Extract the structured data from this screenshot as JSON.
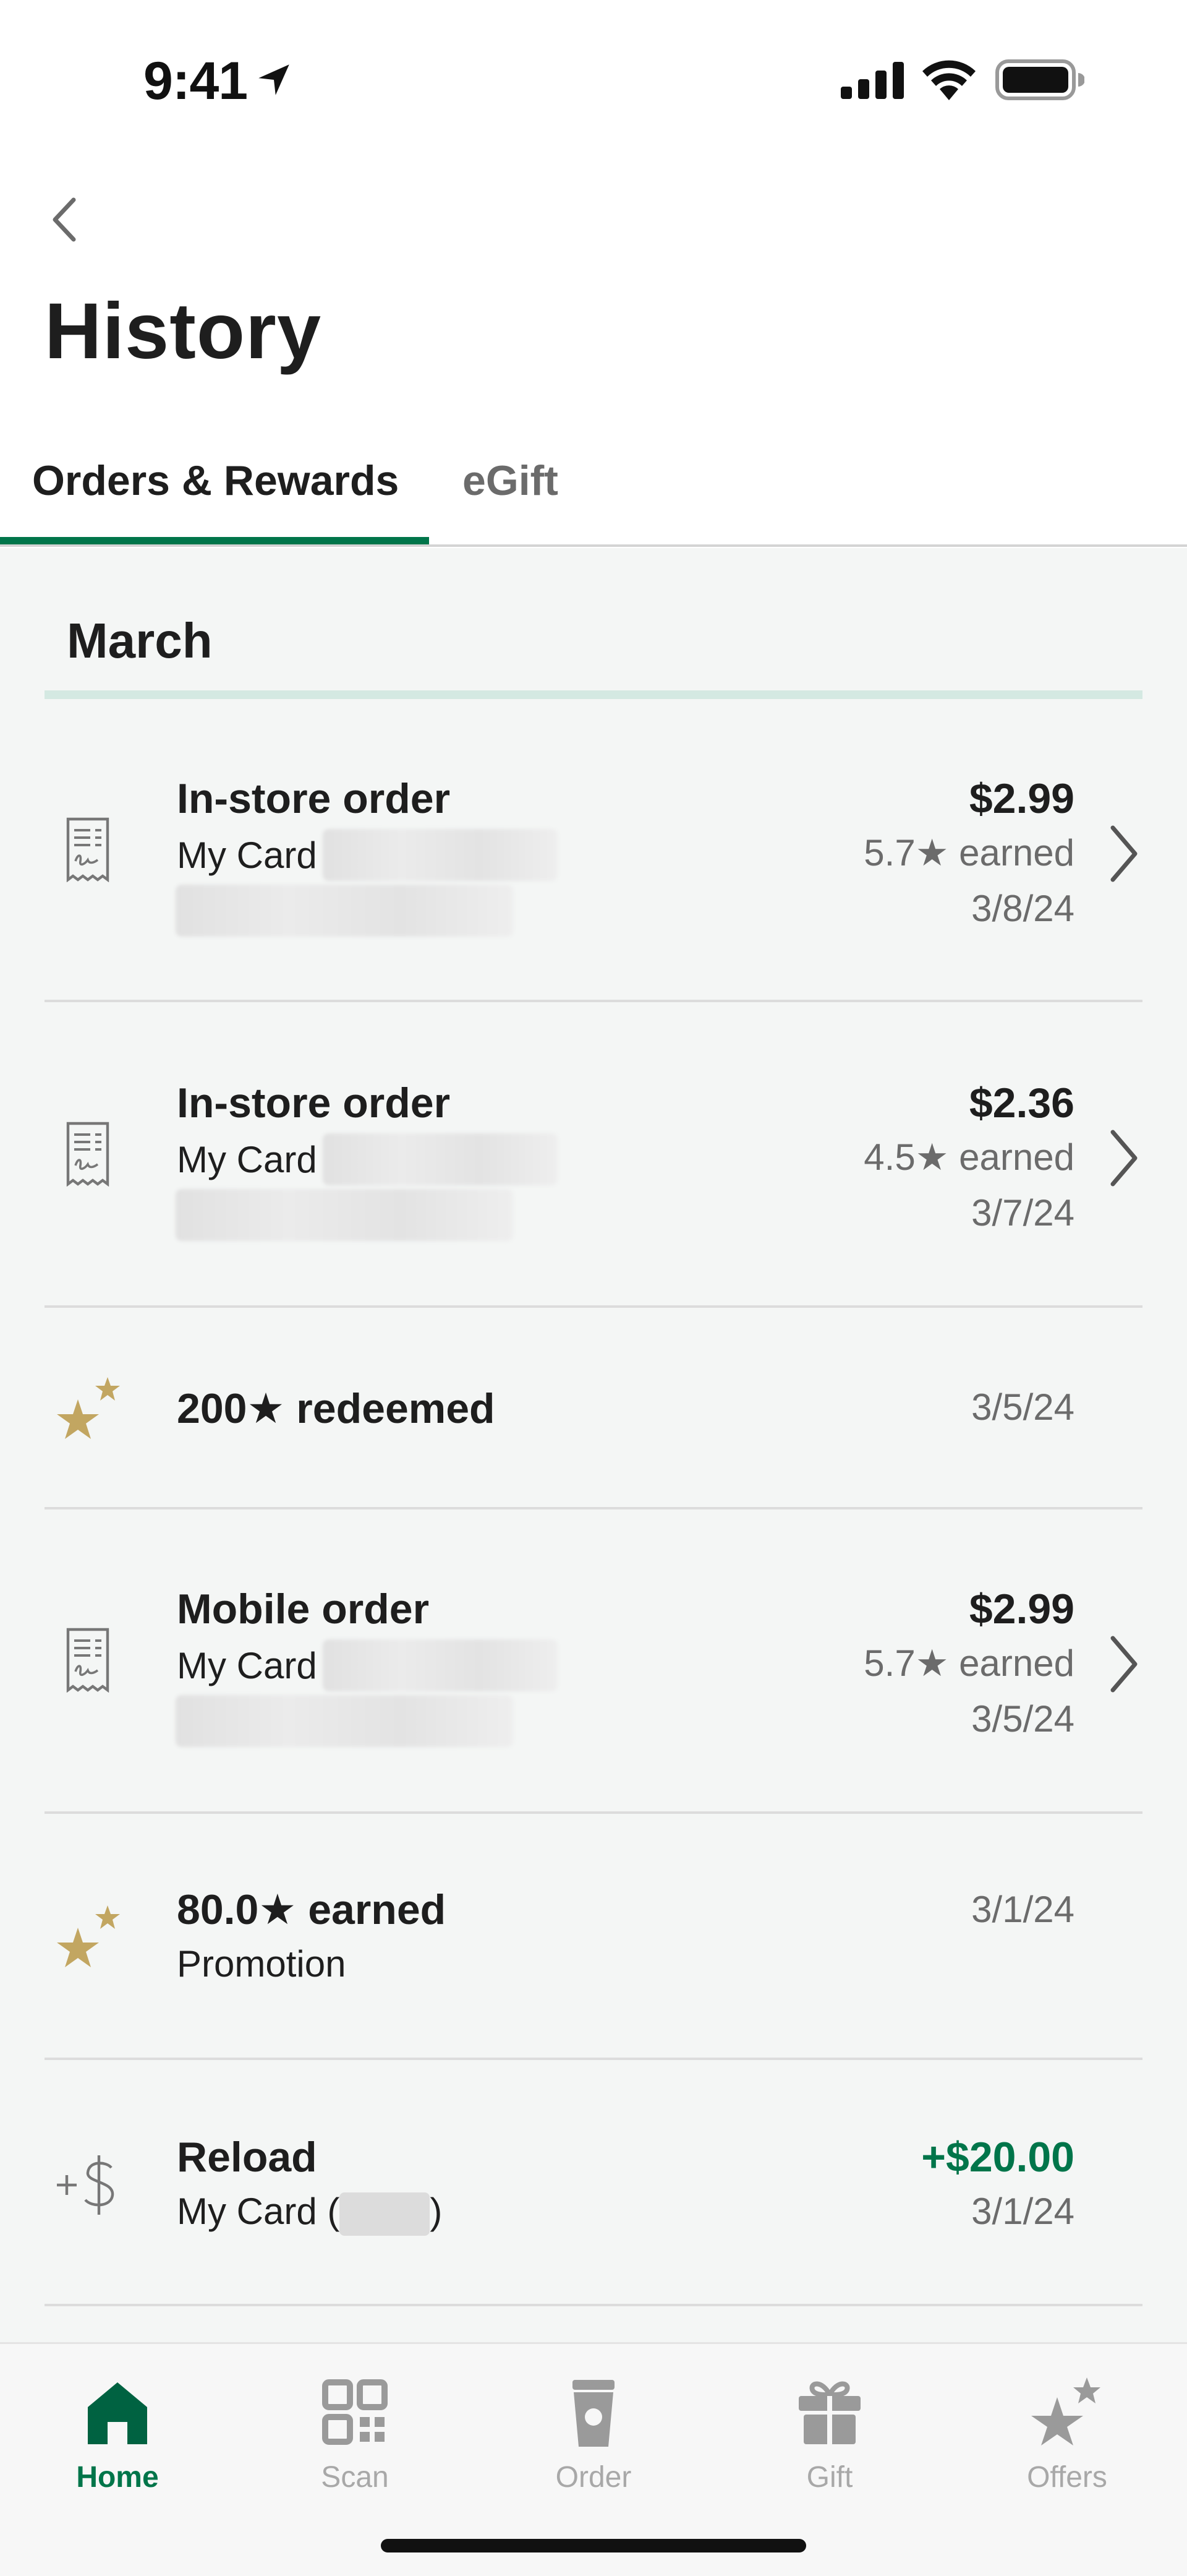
{
  "status_bar": {
    "time": "9:41"
  },
  "header": {
    "title": "History",
    "tabs": [
      {
        "label": "Orders & Rewards",
        "active": true
      },
      {
        "label": "eGift",
        "active": false
      }
    ]
  },
  "month": "March",
  "transactions": [
    {
      "type": "order",
      "icon": "receipt-icon",
      "title": "In-store order",
      "subtitle": "My Card",
      "amount": "$2.99",
      "earned": "5.7★ earned",
      "date": "3/8/24"
    },
    {
      "type": "order",
      "icon": "receipt-icon",
      "title": "In-store order",
      "subtitle": "My Card",
      "amount": "$2.36",
      "earned": "4.5★ earned",
      "date": "3/7/24"
    },
    {
      "type": "reward",
      "icon": "stars-icon",
      "title": "200★ redeemed",
      "date": "3/5/24"
    },
    {
      "type": "order",
      "icon": "receipt-icon",
      "title": "Mobile order",
      "subtitle": "My Card",
      "amount": "$2.99",
      "earned": "5.7★ earned",
      "date": "3/5/24"
    },
    {
      "type": "reward",
      "icon": "stars-icon",
      "title": "80.0★ earned",
      "subtitle": "Promotion",
      "date": "3/1/24"
    },
    {
      "type": "reload",
      "icon": "reload-dollar-icon",
      "title": "Reload",
      "subtitle_prefix": "My Card (",
      "subtitle_suffix": ")",
      "amount": "+$20.00",
      "date": "3/1/24"
    }
  ],
  "bottom_nav": [
    {
      "label": "Home",
      "icon": "home-icon",
      "active": true
    },
    {
      "label": "Scan",
      "icon": "qr-scan-icon",
      "active": false
    },
    {
      "label": "Order",
      "icon": "cup-icon",
      "active": false
    },
    {
      "label": "Gift",
      "icon": "gift-icon",
      "active": false
    },
    {
      "label": "Offers",
      "icon": "offers-stars-icon",
      "active": false
    }
  ],
  "colors": {
    "brand_green": "#00754a",
    "gold_star": "#c2a661",
    "tab_highlight": "#d4e9e2"
  }
}
